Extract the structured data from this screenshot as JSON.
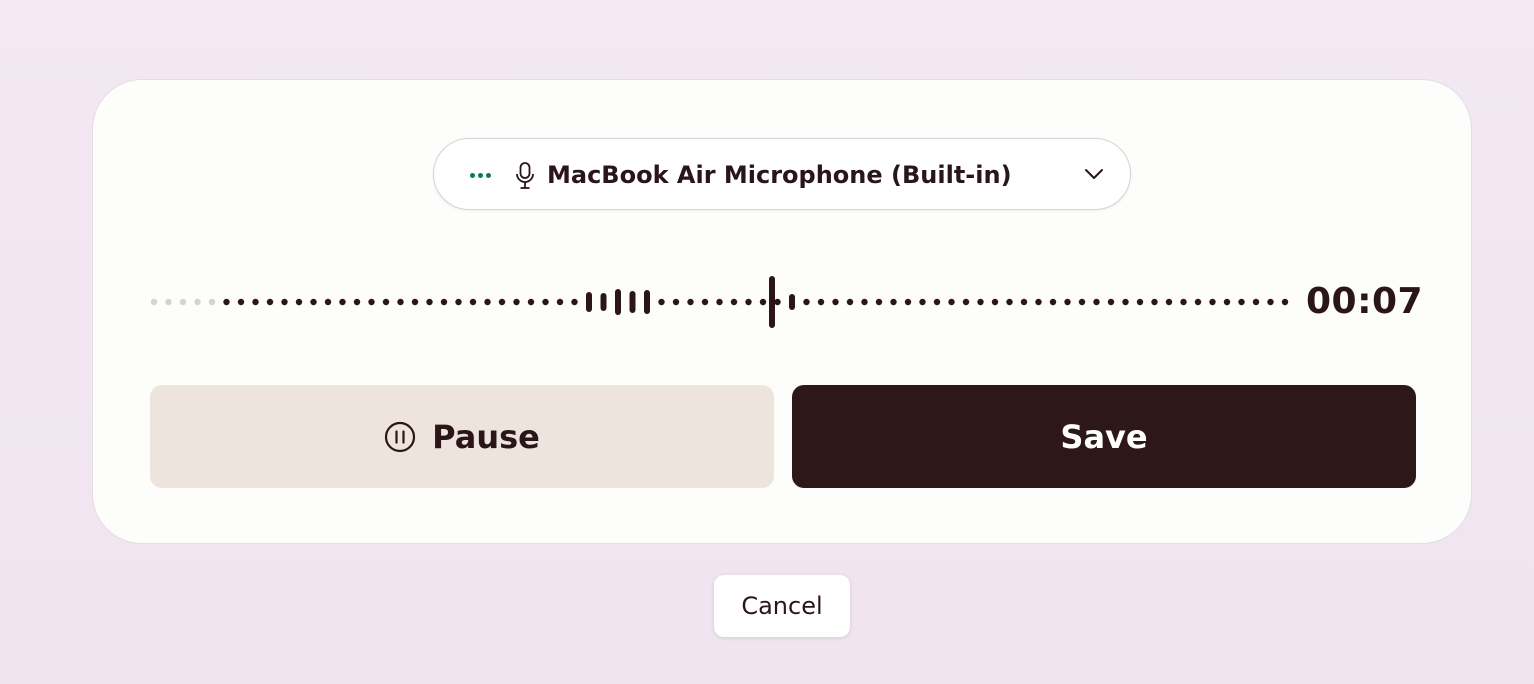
{
  "recorder": {
    "microphone": {
      "selected": "MacBook Air Microphone (Built-in)",
      "status_icon": "dots-icon",
      "icon": "microphone-icon",
      "dropdown_icon": "chevron-down-icon"
    },
    "waveform": {
      "levels": [
        0,
        0,
        0,
        0,
        0,
        1,
        1,
        1,
        1,
        1,
        1,
        1,
        1,
        1,
        1,
        1,
        1,
        1,
        1,
        1,
        1,
        1,
        1,
        1,
        1,
        1,
        1,
        1,
        1,
        1,
        1,
        1,
        1,
        1,
        1,
        1,
        1,
        1,
        1,
        1,
        1,
        1,
        1,
        1,
        1,
        1,
        1,
        1,
        1,
        1,
        1,
        1,
        1,
        1,
        1,
        1,
        1,
        1,
        1,
        1,
        1,
        1,
        1,
        1,
        1,
        1,
        1,
        1,
        1,
        1,
        1,
        1,
        1,
        1,
        1,
        1,
        1,
        1,
        1,
        1,
        1,
        1,
        1,
        1,
        1,
        1,
        1
      ],
      "played_color": "#2a1619",
      "unplayed_color": "#d9d3cf"
    },
    "timer": "00:07",
    "pause_button": {
      "label": "Pause",
      "icon": "pause-circle-icon"
    },
    "save_button": {
      "label": "Save"
    }
  },
  "cancel_button": {
    "label": "Cancel"
  },
  "colors": {
    "background": "#f3e8f3",
    "card": "#fdfdfb",
    "dark": "#2e1719",
    "pause_bg": "#ede5dd",
    "accent": "#0e7a5a"
  }
}
